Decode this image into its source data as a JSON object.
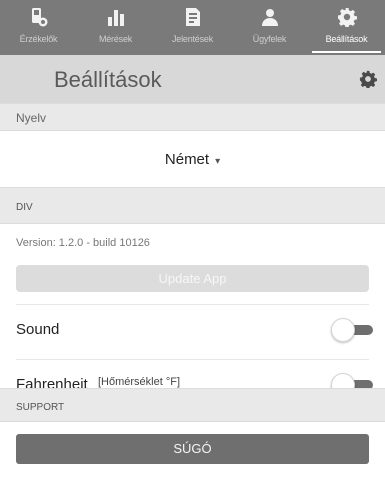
{
  "tabs": [
    {
      "label": "Érzékelők",
      "icon": "sensor-icon",
      "active": false
    },
    {
      "label": "Mérések",
      "icon": "bar-chart-icon",
      "active": false
    },
    {
      "label": "Jelentések",
      "icon": "report-icon",
      "active": false
    },
    {
      "label": "Ügyfelek",
      "icon": "users-icon",
      "active": false
    },
    {
      "label": "Beállítások",
      "icon": "gear-icon",
      "active": true
    }
  ],
  "header": {
    "title": "Beállítások",
    "icon": "gear-icon"
  },
  "language": {
    "section_label": "Nyelv",
    "selected": "Német",
    "caret": "▾"
  },
  "div": {
    "section_label": "DIV",
    "version_text": "Version: 1.2.0 - build 10126",
    "update_button": "Update App"
  },
  "settings": {
    "sound_label": "Sound",
    "sound_on": false,
    "fahrenheit_label": "Fahrenheit",
    "fahrenheit_sub": "[Hőmérséklet °F]",
    "fahrenheit_on": false
  },
  "support": {
    "section_label": "SUPPORT",
    "help_button": "SÚGÓ"
  },
  "colors": {
    "tabbar": "#7a7a7a",
    "header": "#d8d8d8",
    "section": "#e9e9e9",
    "toggle_track": "#6e6e6e",
    "help_button": "#6f6f6f"
  }
}
